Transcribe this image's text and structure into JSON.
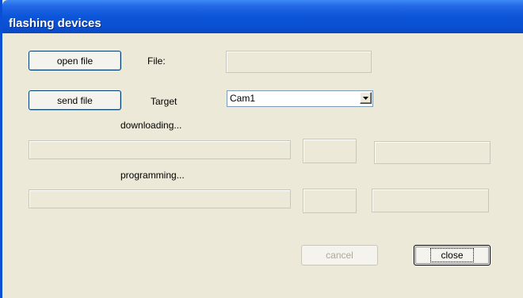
{
  "window": {
    "title": "flashing devices"
  },
  "buttons": {
    "open_file": "open file",
    "send_file": "send file",
    "cancel": "cancel",
    "close": "close"
  },
  "labels": {
    "file": "File:",
    "target": "Target",
    "downloading": "downloading...",
    "programming": "programming..."
  },
  "fields": {
    "file_path": ""
  },
  "target_select": {
    "selected": "Cam1"
  },
  "progress": {
    "downloading": {
      "fraction": 0,
      "count": "",
      "status": ""
    },
    "programming": {
      "fraction": 0,
      "count": "",
      "status": ""
    }
  },
  "colors": {
    "title_bar": "#0a4fd6",
    "window_bg": "#ece9d8"
  },
  "icons": {
    "dropdown": "chevron-down-icon"
  }
}
